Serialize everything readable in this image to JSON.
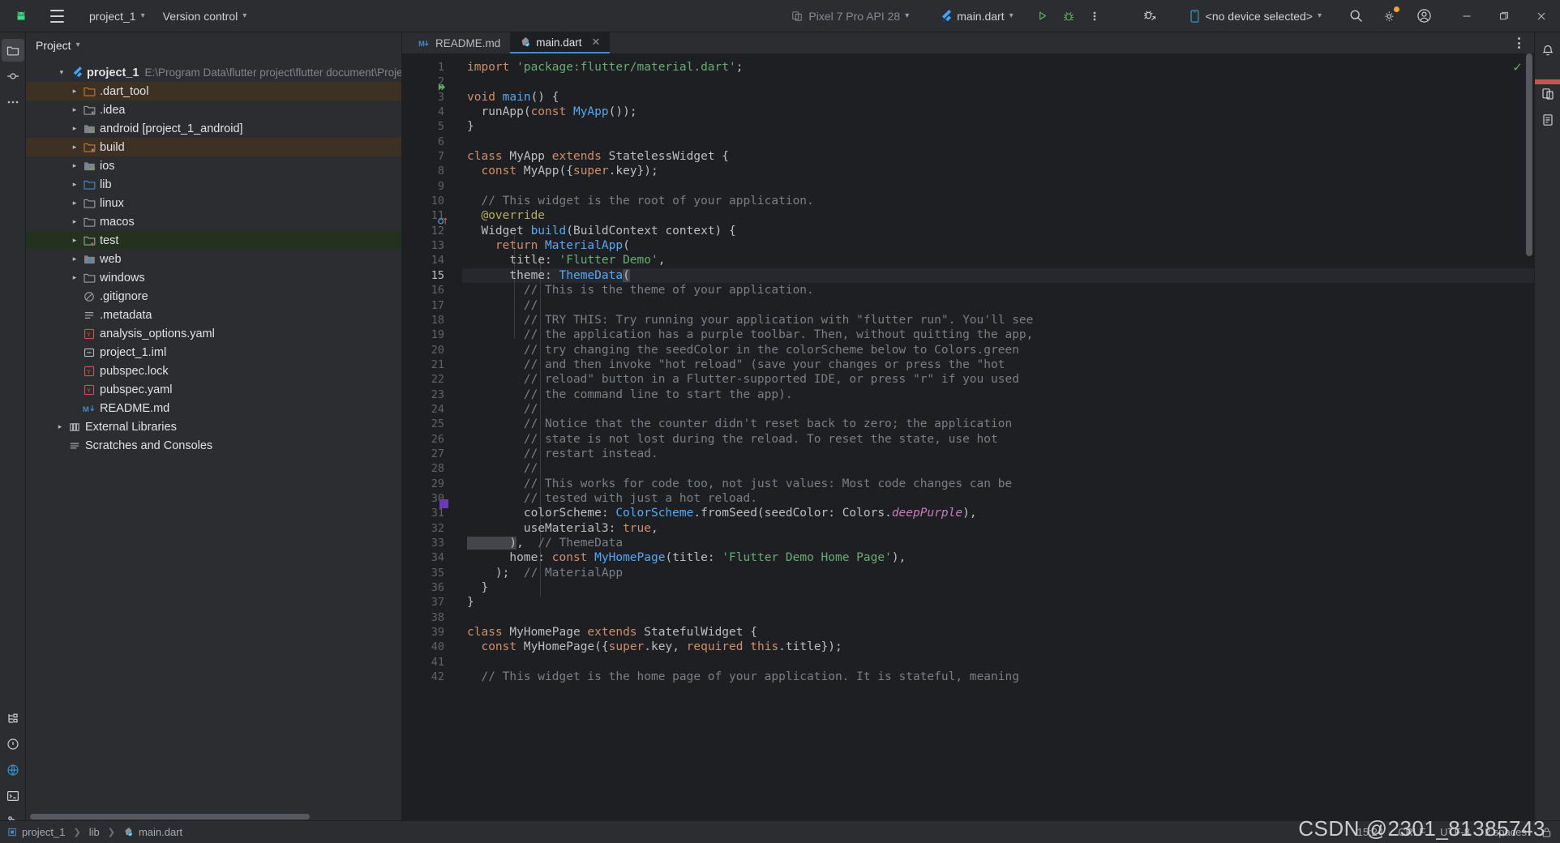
{
  "toolbar": {
    "app_icon": "android-studio-icon",
    "menu_icon": "hamburger-menu-icon",
    "project_name": "project_1",
    "version_control": "Version control",
    "device_target": "Pixel 7 Pro API 28",
    "run_config": "main.dart",
    "run_icon": "run-play-icon",
    "debug_icon": "debug-bug-icon",
    "more_icon": "more-vertical-icon",
    "profile_icon": "profile-run-icon",
    "device_selector": "<no device selected>",
    "search_icon": "search-icon",
    "settings_icon": "gear-icon",
    "account_icon": "account-avatar-icon",
    "minimize": "minimize-icon",
    "maximize": "maximize-icon",
    "close": "close-icon"
  },
  "leftrail": {
    "items": [
      {
        "name": "project-tool-icon",
        "glyph": "folder"
      },
      {
        "name": "commit-tool-icon",
        "glyph": "commit"
      },
      {
        "name": "more-tool-icon",
        "glyph": "dots"
      }
    ],
    "bottom": [
      {
        "name": "structure-tool-icon",
        "glyph": "structure"
      },
      {
        "name": "problems-tool-icon",
        "glyph": "problems"
      },
      {
        "name": "services-tool-icon",
        "glyph": "services"
      },
      {
        "name": "terminal-tool-icon",
        "glyph": "terminal"
      },
      {
        "name": "git-tool-icon",
        "glyph": "git"
      }
    ]
  },
  "rightrail": {
    "items": [
      {
        "name": "notifications-icon"
      },
      {
        "name": "device-manager-icon"
      },
      {
        "name": "device-file-explorer-icon"
      }
    ]
  },
  "project_panel": {
    "title": "Project",
    "root": {
      "label": "project_1",
      "path": "E:\\Program Data\\flutter project\\flutter document\\Proje",
      "icon": "flutter-icon",
      "expanded": true
    },
    "tree": [
      {
        "label": ".dart_tool",
        "icon": "folder-orange",
        "arrow": true,
        "indent": 2,
        "highlight": "brown"
      },
      {
        "label": ".idea",
        "icon": "folder-excluded",
        "arrow": true,
        "indent": 2,
        "highlight": ""
      },
      {
        "label": "android [project_1_android]",
        "icon": "folder-module",
        "arrow": true,
        "indent": 2,
        "highlight": ""
      },
      {
        "label": "build",
        "icon": "folder-orange-x",
        "arrow": true,
        "indent": 2,
        "highlight": "brown"
      },
      {
        "label": "ios",
        "icon": "folder-module",
        "arrow": true,
        "indent": 2,
        "highlight": ""
      },
      {
        "label": "lib",
        "icon": "folder-blue",
        "arrow": true,
        "indent": 2,
        "highlight": ""
      },
      {
        "label": "linux",
        "icon": "folder-plain",
        "arrow": true,
        "indent": 2,
        "highlight": ""
      },
      {
        "label": "macos",
        "icon": "folder-plain",
        "arrow": true,
        "indent": 2,
        "highlight": ""
      },
      {
        "label": "test",
        "icon": "folder-test",
        "arrow": true,
        "indent": 2,
        "highlight": "green"
      },
      {
        "label": "web",
        "icon": "folder-web",
        "arrow": true,
        "indent": 2,
        "highlight": ""
      },
      {
        "label": "windows",
        "icon": "folder-plain",
        "arrow": true,
        "indent": 2,
        "highlight": ""
      },
      {
        "label": ".gitignore",
        "icon": "ignore-file",
        "arrow": false,
        "indent": 2,
        "highlight": ""
      },
      {
        "label": ".metadata",
        "icon": "text-file",
        "arrow": false,
        "indent": 2,
        "highlight": ""
      },
      {
        "label": "analysis_options.yaml",
        "icon": "yaml-file",
        "arrow": false,
        "indent": 2,
        "highlight": ""
      },
      {
        "label": "project_1.iml",
        "icon": "iml-file",
        "arrow": false,
        "indent": 2,
        "highlight": ""
      },
      {
        "label": "pubspec.lock",
        "icon": "yaml-file",
        "arrow": false,
        "indent": 2,
        "highlight": ""
      },
      {
        "label": "pubspec.yaml",
        "icon": "yaml-file",
        "arrow": false,
        "indent": 2,
        "highlight": ""
      },
      {
        "label": "README.md",
        "icon": "markdown-file",
        "arrow": false,
        "indent": 2,
        "highlight": ""
      },
      {
        "label": "External Libraries",
        "icon": "library-icon",
        "arrow": true,
        "indent": 1,
        "highlight": ""
      },
      {
        "label": "Scratches and Consoles",
        "icon": "scratches-icon",
        "arrow": false,
        "indent": 1,
        "highlight": ""
      }
    ]
  },
  "editor": {
    "tabs": [
      {
        "label": "README.md",
        "icon": "markdown-file",
        "active": false,
        "closable": false
      },
      {
        "label": "main.dart",
        "icon": "dart-file",
        "active": true,
        "closable": true
      }
    ],
    "options_icon": "editor-options-icon",
    "inspection_status": "inspections-ok-check",
    "current_line": 15,
    "gutter_markers": [
      {
        "line": 3,
        "type": "run-gutter-icon"
      },
      {
        "line": 12,
        "type": "override-gutter-icon"
      },
      {
        "line": 31,
        "type": "color-swatch",
        "color": "#6a3ab2"
      }
    ],
    "lines": [
      {
        "n": 1,
        "tokens": [
          {
            "t": "import ",
            "c": "kw"
          },
          {
            "t": "'package:flutter/material.dart'",
            "c": "str"
          },
          {
            "t": ";",
            "c": "plain"
          }
        ]
      },
      {
        "n": 2,
        "tokens": []
      },
      {
        "n": 3,
        "tokens": [
          {
            "t": "void ",
            "c": "kw"
          },
          {
            "t": "main",
            "c": "fn"
          },
          {
            "t": "() {",
            "c": "plain"
          }
        ]
      },
      {
        "n": 4,
        "tokens": [
          {
            "t": "  runApp(",
            "c": "plain"
          },
          {
            "t": "const ",
            "c": "kw"
          },
          {
            "t": "MyApp",
            "c": "type"
          },
          {
            "t": "());",
            "c": "plain"
          }
        ]
      },
      {
        "n": 5,
        "tokens": [
          {
            "t": "}",
            "c": "plain"
          }
        ]
      },
      {
        "n": 6,
        "tokens": []
      },
      {
        "n": 7,
        "tokens": [
          {
            "t": "class ",
            "c": "kw"
          },
          {
            "t": "MyApp ",
            "c": "plain"
          },
          {
            "t": "extends ",
            "c": "kw"
          },
          {
            "t": "StatelessWidget {",
            "c": "plain"
          }
        ]
      },
      {
        "n": 8,
        "tokens": [
          {
            "t": "  ",
            "c": "plain"
          },
          {
            "t": "const ",
            "c": "kw"
          },
          {
            "t": "MyApp({",
            "c": "plain"
          },
          {
            "t": "super",
            "c": "kw"
          },
          {
            "t": ".key});",
            "c": "plain"
          }
        ]
      },
      {
        "n": 9,
        "tokens": []
      },
      {
        "n": 10,
        "tokens": [
          {
            "t": "  // This widget is the root of your application.",
            "c": "com"
          }
        ]
      },
      {
        "n": 11,
        "tokens": [
          {
            "t": "  @override",
            "c": "ann"
          }
        ]
      },
      {
        "n": 12,
        "tokens": [
          {
            "t": "  Widget ",
            "c": "plain"
          },
          {
            "t": "build",
            "c": "fn"
          },
          {
            "t": "(BuildContext context) {",
            "c": "plain"
          }
        ]
      },
      {
        "n": 13,
        "tokens": [
          {
            "t": "    ",
            "c": "plain"
          },
          {
            "t": "return ",
            "c": "kw"
          },
          {
            "t": "MaterialApp",
            "c": "type"
          },
          {
            "t": "(",
            "c": "plain"
          }
        ]
      },
      {
        "n": 14,
        "tokens": [
          {
            "t": "      title: ",
            "c": "plain"
          },
          {
            "t": "'Flutter Demo'",
            "c": "str"
          },
          {
            "t": ",",
            "c": "plain"
          }
        ]
      },
      {
        "n": 15,
        "tokens": [
          {
            "t": "      theme: ",
            "c": "plain"
          },
          {
            "t": "ThemeData",
            "c": "type"
          },
          {
            "t": "(",
            "c": "selparen"
          }
        ]
      },
      {
        "n": 16,
        "tokens": [
          {
            "t": "        // This is the theme of your application.",
            "c": "com"
          }
        ]
      },
      {
        "n": 17,
        "tokens": [
          {
            "t": "        //",
            "c": "com"
          }
        ]
      },
      {
        "n": 18,
        "tokens": [
          {
            "t": "        // TRY THIS: Try running your application with \"flutter run\". You'll see",
            "c": "com"
          }
        ]
      },
      {
        "n": 19,
        "tokens": [
          {
            "t": "        // the application has a purple toolbar. Then, without quitting the app,",
            "c": "com"
          }
        ]
      },
      {
        "n": 20,
        "tokens": [
          {
            "t": "        // try changing the seedColor in the colorScheme below to Colors.green",
            "c": "com"
          }
        ]
      },
      {
        "n": 21,
        "tokens": [
          {
            "t": "        // and then invoke \"hot reload\" (save your changes or press the \"hot",
            "c": "com"
          }
        ]
      },
      {
        "n": 22,
        "tokens": [
          {
            "t": "        // reload\" button in a Flutter-supported IDE, or press \"r\" if you used",
            "c": "com"
          }
        ]
      },
      {
        "n": 23,
        "tokens": [
          {
            "t": "        // the command line to start the app).",
            "c": "com"
          }
        ]
      },
      {
        "n": 24,
        "tokens": [
          {
            "t": "        //",
            "c": "com"
          }
        ]
      },
      {
        "n": 25,
        "tokens": [
          {
            "t": "        // Notice that the counter didn't reset back to zero; the application",
            "c": "com"
          }
        ]
      },
      {
        "n": 26,
        "tokens": [
          {
            "t": "        // state is not lost during the reload. To reset the state, use hot",
            "c": "com"
          }
        ]
      },
      {
        "n": 27,
        "tokens": [
          {
            "t": "        // restart instead.",
            "c": "com"
          }
        ]
      },
      {
        "n": 28,
        "tokens": [
          {
            "t": "        //",
            "c": "com"
          }
        ]
      },
      {
        "n": 29,
        "tokens": [
          {
            "t": "        // This works for code too, not just values: Most code changes can be",
            "c": "com"
          }
        ]
      },
      {
        "n": 30,
        "tokens": [
          {
            "t": "        // tested with just a hot reload.",
            "c": "com"
          }
        ]
      },
      {
        "n": 31,
        "tokens": [
          {
            "t": "        colorScheme: ",
            "c": "plain"
          },
          {
            "t": "ColorScheme",
            "c": "type"
          },
          {
            "t": ".fromSeed(seedColor: ",
            "c": "plain"
          },
          {
            "t": "Colors",
            "c": "plain"
          },
          {
            "t": ".",
            "c": "plain"
          },
          {
            "t": "deepPurple",
            "c": "field"
          },
          {
            "t": "),",
            "c": "plain"
          }
        ]
      },
      {
        "n": 32,
        "tokens": [
          {
            "t": "        useMaterial3: ",
            "c": "plain"
          },
          {
            "t": "true",
            "c": "kw"
          },
          {
            "t": ",",
            "c": "plain"
          }
        ]
      },
      {
        "n": 33,
        "tokens": [
          {
            "t": "      )",
            "c": "selparen"
          },
          {
            "t": ",  ",
            "c": "plain"
          },
          {
            "t": "// ThemeData",
            "c": "com"
          }
        ]
      },
      {
        "n": 34,
        "tokens": [
          {
            "t": "      home: ",
            "c": "plain"
          },
          {
            "t": "const ",
            "c": "kw"
          },
          {
            "t": "MyHomePage",
            "c": "type"
          },
          {
            "t": "(title: ",
            "c": "plain"
          },
          {
            "t": "'Flutter Demo Home Page'",
            "c": "str"
          },
          {
            "t": "),",
            "c": "plain"
          }
        ]
      },
      {
        "n": 35,
        "tokens": [
          {
            "t": "    );  ",
            "c": "plain"
          },
          {
            "t": "// MaterialApp",
            "c": "com"
          }
        ]
      },
      {
        "n": 36,
        "tokens": [
          {
            "t": "  }",
            "c": "plain"
          }
        ]
      },
      {
        "n": 37,
        "tokens": [
          {
            "t": "}",
            "c": "plain"
          }
        ]
      },
      {
        "n": 38,
        "tokens": []
      },
      {
        "n": 39,
        "tokens": [
          {
            "t": "class ",
            "c": "kw"
          },
          {
            "t": "MyHomePage ",
            "c": "plain"
          },
          {
            "t": "extends ",
            "c": "kw"
          },
          {
            "t": "StatefulWidget {",
            "c": "plain"
          }
        ]
      },
      {
        "n": 40,
        "tokens": [
          {
            "t": "  ",
            "c": "plain"
          },
          {
            "t": "const ",
            "c": "kw"
          },
          {
            "t": "MyHomePage({",
            "c": "plain"
          },
          {
            "t": "super",
            "c": "kw"
          },
          {
            "t": ".key, ",
            "c": "plain"
          },
          {
            "t": "required ",
            "c": "kw"
          },
          {
            "t": "this",
            "c": "kw"
          },
          {
            "t": ".title});",
            "c": "plain"
          }
        ]
      },
      {
        "n": 41,
        "tokens": []
      },
      {
        "n": 42,
        "tokens": [
          {
            "t": "  // This widget is the home page of your application. It is stateful, meaning",
            "c": "com"
          }
        ]
      }
    ]
  },
  "statusbar": {
    "breadcrumb": [
      "project_1",
      "lib",
      "main.dart"
    ],
    "time": "15:24",
    "encoding": "CRLF",
    "charset": "UTF-8",
    "indent": "2 spaces",
    "lock_icon": "lock-icon",
    "watermark": "CSDN @2301_81385743"
  }
}
